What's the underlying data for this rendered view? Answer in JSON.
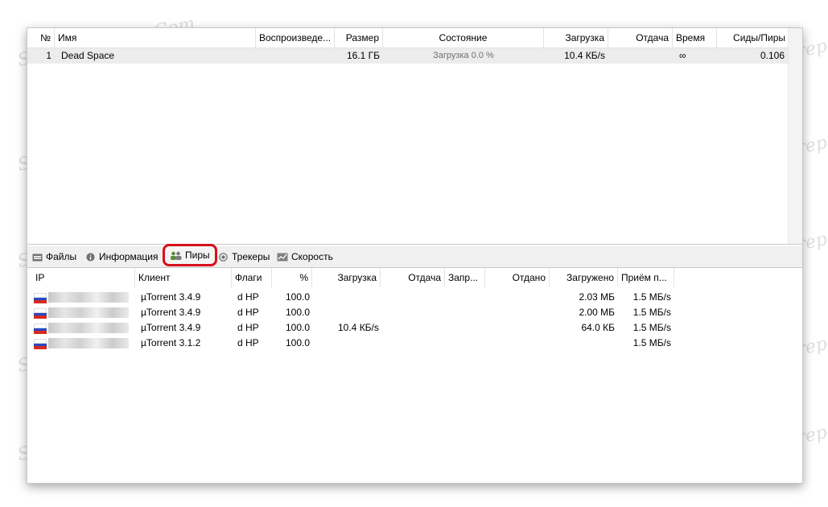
{
  "torrents": {
    "columns": [
      "№",
      "Имя",
      "Воспроизведе...",
      "Размер",
      "Состояние",
      "Загрузка",
      "Отдача",
      "Время",
      "Сиды/Пиры"
    ],
    "rows": [
      {
        "num": "1",
        "name": "Dead Space",
        "play": "",
        "size": "16.1 ГБ",
        "status": "Загрузка 0.0 %",
        "down": "10.4 КБ/s",
        "up": "",
        "time": "∞",
        "ratio": "0.106"
      }
    ]
  },
  "tabs": [
    {
      "label": "Файлы",
      "icon": "files-icon"
    },
    {
      "label": "Информация",
      "icon": "info-icon"
    },
    {
      "label": "Пиры",
      "icon": "peers-icon",
      "active": true,
      "highlight_color": "#d8101b"
    },
    {
      "label": "Трекеры",
      "icon": "trackers-icon"
    },
    {
      "label": "Скорость",
      "icon": "speed-chart-icon"
    }
  ],
  "peers": {
    "columns": [
      "IP",
      "Клиент",
      "Флаги",
      "%",
      "Загрузка",
      "Отдача",
      "Запр...",
      "Отдано",
      "Загружено",
      "Приём п..."
    ],
    "rows": [
      {
        "client": "µTorrent 3.4.9",
        "flags": "d HP",
        "pct": "100.0",
        "down": "",
        "up": "",
        "req": "",
        "sent": "",
        "received": "2.03 МБ",
        "recv_rate": "1.5 МБ/s"
      },
      {
        "client": "µTorrent 3.4.9",
        "flags": "d HP",
        "pct": "100.0",
        "down": "",
        "up": "",
        "req": "",
        "sent": "",
        "received": "2.00 МБ",
        "recv_rate": "1.5 МБ/s"
      },
      {
        "client": "µTorrent 3.4.9",
        "flags": "d HP",
        "pct": "100.0",
        "down": "10.4 КБ/s",
        "up": "",
        "req": "",
        "sent": "",
        "received": "64.0 КБ",
        "recv_rate": "1.5 МБ/s"
      },
      {
        "client": "µTorrent 3.1.2",
        "flags": "d HP",
        "pct": "100.0",
        "down": "",
        "up": "",
        "req": "",
        "sent": "",
        "received": "",
        "recv_rate": "1.5 МБ/s"
      }
    ]
  },
  "watermark": "Soringpcrepair.Com"
}
